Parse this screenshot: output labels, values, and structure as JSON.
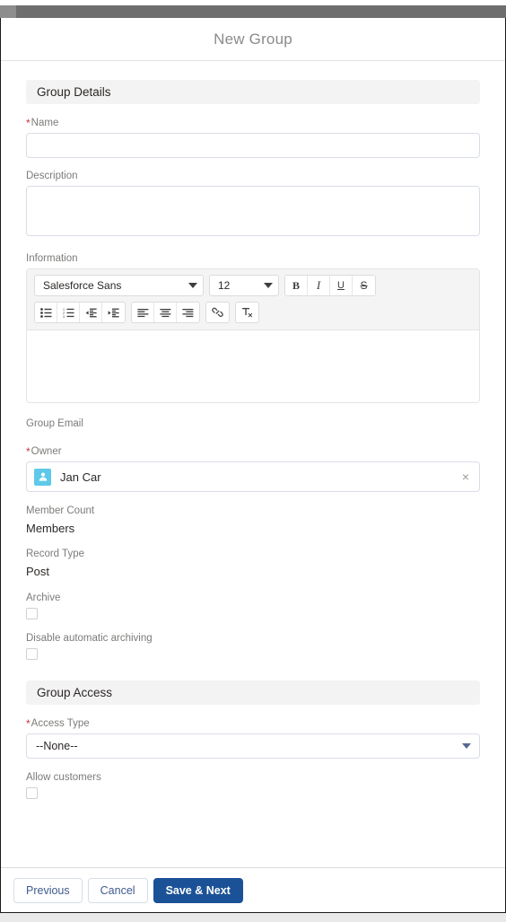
{
  "modal": {
    "title": "New Group"
  },
  "sections": [
    {
      "title": "Group Details"
    },
    {
      "title": "Group Access"
    }
  ],
  "group_details": {
    "name": {
      "label": "Name",
      "required": true,
      "value": "",
      "placeholder": ""
    },
    "description": {
      "label": "Description",
      "required": false,
      "value": "",
      "placeholder": ""
    },
    "information": {
      "label": "Information",
      "value": "",
      "toolbar": {
        "font_family": "Salesforce Sans",
        "font_size": "12",
        "buttons_row1": [
          {
            "name": "bold-button",
            "glyph": "B"
          },
          {
            "name": "italic-button",
            "glyph": "I"
          },
          {
            "name": "underline-button",
            "glyph": "U"
          },
          {
            "name": "strikethrough-button",
            "glyph": "S"
          }
        ],
        "buttons_row2": [
          {
            "name": "bulleted-list-icon"
          },
          {
            "name": "numbered-list-icon"
          },
          {
            "name": "outdent-icon"
          },
          {
            "name": "indent-icon"
          },
          {
            "name": "align-left-icon"
          },
          {
            "name": "align-center-icon"
          },
          {
            "name": "align-right-icon"
          },
          {
            "name": "link-icon"
          },
          {
            "name": "remove-formatting-icon"
          }
        ]
      }
    },
    "group_email": {
      "label": "Group Email",
      "value": ""
    },
    "owner": {
      "label": "Owner",
      "required": true,
      "value": "Jan Car",
      "avatar_icon": "user-avatar-icon",
      "clear_icon": "×"
    },
    "member_count": {
      "label": "Member Count",
      "value": "Members"
    },
    "record_type": {
      "label": "Record Type",
      "value": "Post"
    },
    "archive": {
      "label": "Archive",
      "checked": false
    },
    "disable_automatic_archiving": {
      "label": "Disable automatic archiving",
      "checked": false
    }
  },
  "group_access": {
    "access_type": {
      "label": "Access Type",
      "required": true,
      "value": "--None--",
      "options": [
        "--None--"
      ]
    },
    "allow_customers": {
      "label": "Allow customers",
      "checked": false
    }
  },
  "footer": {
    "previous_label": "Previous",
    "cancel_label": "Cancel",
    "save_next_label": "Save & Next"
  },
  "colors": {
    "brand_blue": "#1b5297",
    "link_blue": "#3f5a8d",
    "required_red": "#c23934",
    "avatar_cyan": "#5ec9e8",
    "section_bg": "#f3f3f3"
  }
}
